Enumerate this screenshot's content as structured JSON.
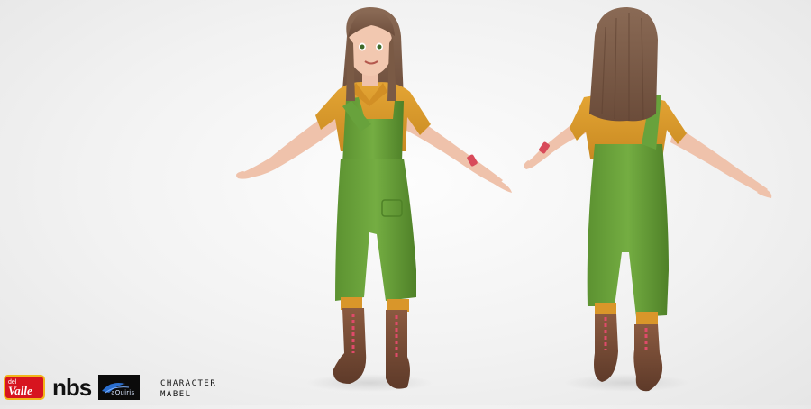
{
  "caption": {
    "line1": "CHARACTER",
    "line2": "MABEL"
  },
  "logos": {
    "brand1": "Valle",
    "brand1_prefix": "del",
    "brand2": "nbs",
    "brand3": "aQuiris"
  },
  "colors": {
    "background": "#f2f2f2",
    "shirt": "#d99a2b",
    "overalls": "#6aa23a",
    "hair": "#7a5a45",
    "skin": "#f0c4ad",
    "boots": "#7a4a35",
    "laces": "#e04a6a",
    "valle_red": "#d7141f",
    "aquiris_bg": "#0b0b0b"
  }
}
